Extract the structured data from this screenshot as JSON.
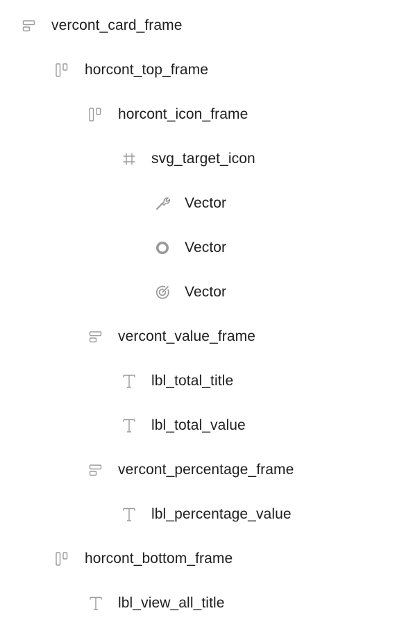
{
  "layers": [
    {
      "label": "vercont_card_frame",
      "icon": "vertical-autolayout-icon",
      "depth": 0
    },
    {
      "label": "horcont_top_frame",
      "icon": "horizontal-autolayout-icon",
      "depth": 1
    },
    {
      "label": "horcont_icon_frame",
      "icon": "horizontal-autolayout-icon",
      "depth": 2
    },
    {
      "label": "svg_target_icon",
      "icon": "frame-hash-icon",
      "depth": 3
    },
    {
      "label": "Vector",
      "icon": "wrench-vector-icon",
      "depth": 4
    },
    {
      "label": "Vector",
      "icon": "ring-vector-icon",
      "depth": 4
    },
    {
      "label": "Vector",
      "icon": "target-vector-icon",
      "depth": 4
    },
    {
      "label": "vercont_value_frame",
      "icon": "vertical-autolayout-icon",
      "depth": 2
    },
    {
      "label": "lbl_total_title",
      "icon": "text-icon",
      "depth": 3
    },
    {
      "label": "lbl_total_value",
      "icon": "text-icon",
      "depth": 3
    },
    {
      "label": "vercont_percentage_frame",
      "icon": "vertical-autolayout-icon",
      "depth": 2
    },
    {
      "label": "lbl_percentage_value",
      "icon": "text-icon",
      "depth": 3
    },
    {
      "label": "horcont_bottom_frame",
      "icon": "horizontal-autolayout-icon",
      "depth": 1
    },
    {
      "label": "lbl_view_all_title",
      "icon": "text-icon",
      "depth": 2
    }
  ],
  "colors": {
    "icon": "#9a9a9a",
    "text": "#1e1e1e",
    "background": "#ffffff"
  }
}
